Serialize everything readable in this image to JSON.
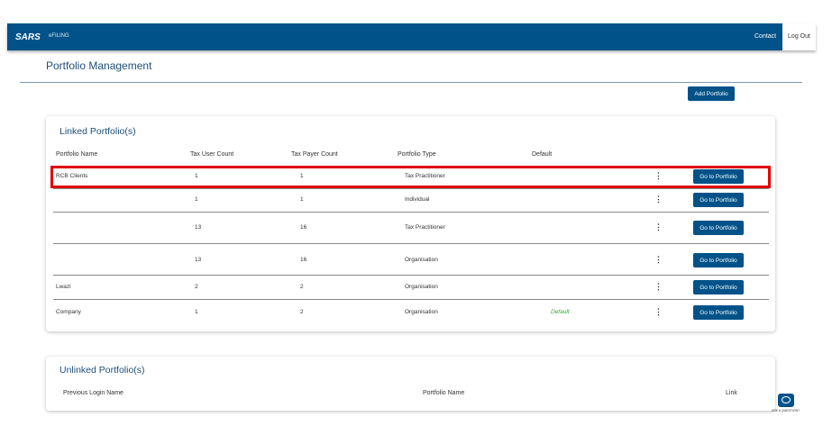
{
  "header": {
    "logo": "SARS",
    "sublogo": "eFILING",
    "contact": "Contact",
    "logout": "Log Out"
  },
  "page": {
    "title": "Portfolio Management",
    "add_button": "Add Portfolio"
  },
  "linked": {
    "title": "Linked Portfolio(s)",
    "columns": [
      "Portfolio Name",
      "Tax User Count",
      "Tax Payer Count",
      "Portfolio Type",
      "Default"
    ],
    "go_label": "Go to Portfolio",
    "rows": [
      {
        "name": "RCB Clients",
        "users": "1",
        "payers": "1",
        "type": "Tax Practitioner",
        "default": ""
      },
      {
        "name": "",
        "users": "1",
        "payers": "1",
        "type": "Individual",
        "default": ""
      },
      {
        "name": "",
        "users": "13",
        "payers": "16",
        "type": "Tax Practitioner",
        "default": ""
      },
      {
        "name": "",
        "users": "13",
        "payers": "16",
        "type": "Organisation",
        "default": ""
      },
      {
        "name": "Lwazi",
        "users": "2",
        "payers": "2",
        "type": "Organisation",
        "default": ""
      },
      {
        "name": "Company",
        "users": "1",
        "payers": "2",
        "type": "Organisation",
        "default": "Default"
      }
    ]
  },
  "unlinked": {
    "title": "Unlinked Portfolio(s)",
    "columns": [
      "Previous Login Name",
      "Portfolio Name",
      "Link"
    ]
  },
  "ask": {
    "label": "ASK A QUESTION?",
    "icon": "chat-icon"
  },
  "colors": {
    "brand": "#005288",
    "highlight": "#e00000",
    "default": "#3aa23a"
  }
}
